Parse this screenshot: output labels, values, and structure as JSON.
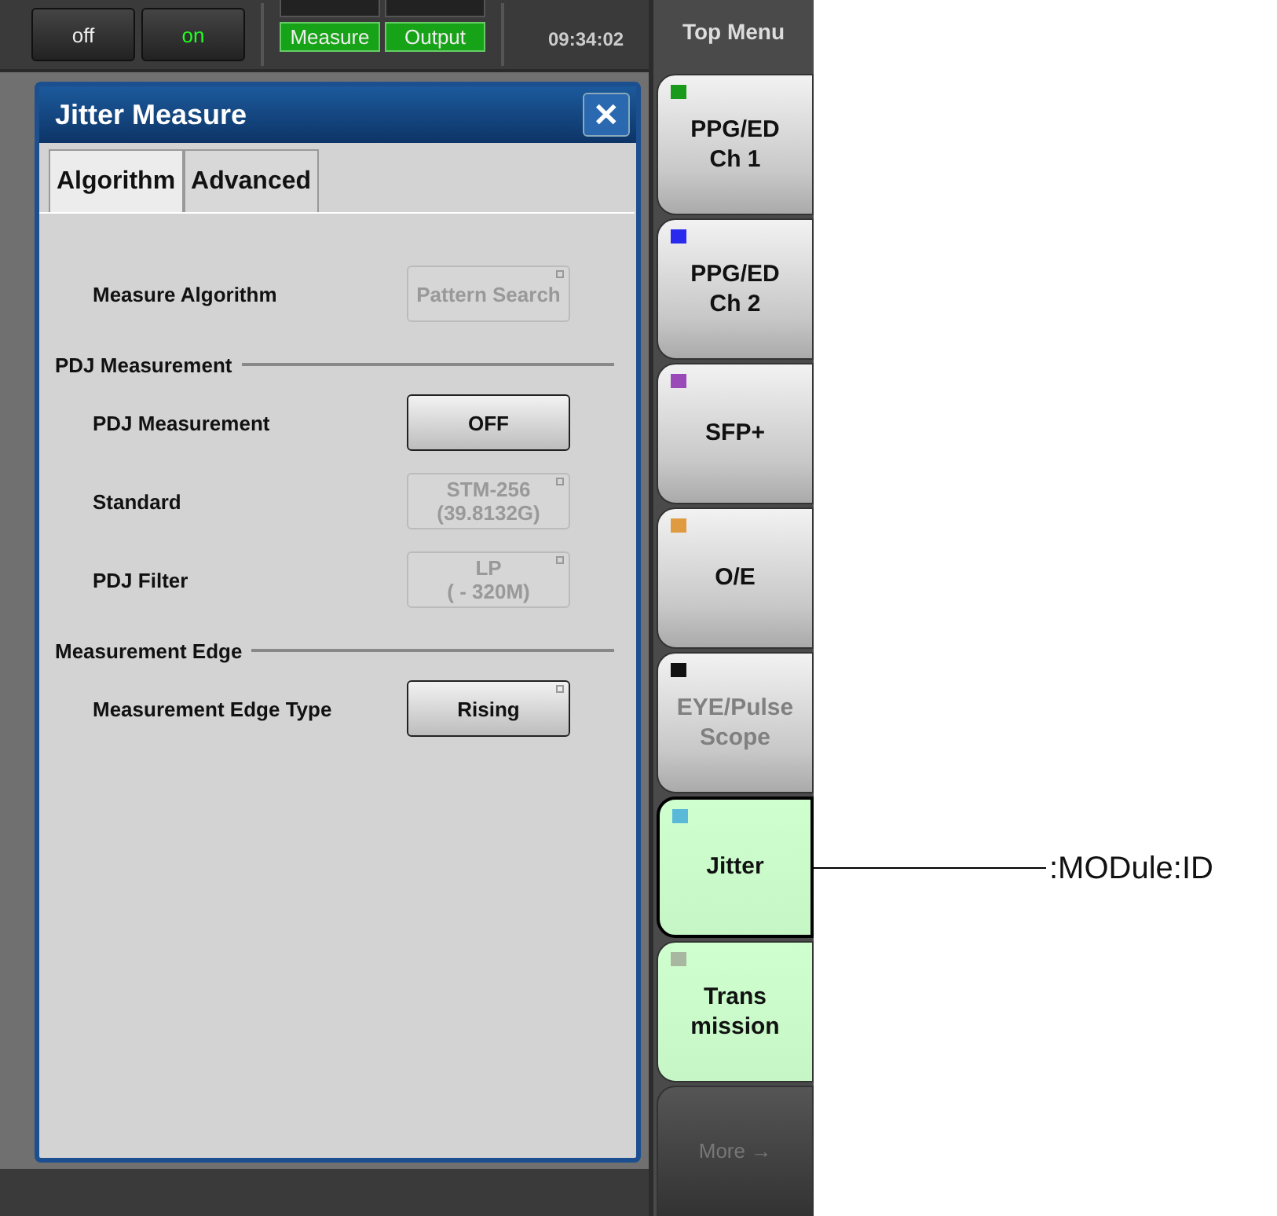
{
  "top_bar": {
    "buttons": [
      {
        "label": "off",
        "on": false
      },
      {
        "label": "on",
        "on": true
      }
    ],
    "indicators": [
      {
        "label": "Measure",
        "lit": true
      },
      {
        "label": "Output",
        "lit": true
      }
    ],
    "time": "09:34:02"
  },
  "dialog": {
    "title": "Jitter Measure",
    "close_label": "✕",
    "tabs": [
      {
        "label": "Algorithm",
        "selected": true
      },
      {
        "label": "Advanced",
        "selected": false
      }
    ],
    "rows": [
      {
        "kind": "setting",
        "label": "Measure Algorithm",
        "value": "Pattern Search",
        "disabled": true,
        "dropdown": true
      },
      {
        "kind": "section",
        "label": "PDJ Measurement"
      },
      {
        "kind": "setting",
        "label": "PDJ Measurement",
        "value": "OFF",
        "disabled": false,
        "dropdown": false
      },
      {
        "kind": "setting",
        "label": "Standard",
        "value": "STM-256\n(39.8132G)",
        "disabled": true,
        "dropdown": true
      },
      {
        "kind": "setting",
        "label": "PDJ Filter",
        "value": "LP\n( - 320M)",
        "disabled": true,
        "dropdown": true
      },
      {
        "kind": "section",
        "label": "Measurement Edge"
      },
      {
        "kind": "setting",
        "label": "Measurement Edge Type",
        "value": "Rising",
        "disabled": false,
        "dropdown": true
      }
    ]
  },
  "side_menu": {
    "title": "Top Menu",
    "items": [
      {
        "label": "PPG/ED\nCh 1",
        "color": "#1a9a1a",
        "active": false,
        "disabled": false,
        "selected": false
      },
      {
        "label": "PPG/ED\nCh 2",
        "color": "#2a2aee",
        "active": false,
        "disabled": false,
        "selected": false
      },
      {
        "label": "SFP+",
        "color": "#9a4ab8",
        "active": false,
        "disabled": false,
        "selected": false
      },
      {
        "label": "O/E",
        "color": "#e09a40",
        "active": false,
        "disabled": false,
        "selected": false
      },
      {
        "label": "EYE/Pulse\nScope",
        "color": "#111111",
        "active": false,
        "disabled": true,
        "selected": false
      },
      {
        "label": "Jitter",
        "color": "#5ab8d8",
        "active": true,
        "disabled": false,
        "selected": true
      },
      {
        "label": "Trans\nmission",
        "color": "#a8b8a0",
        "active": true,
        "disabled": false,
        "selected": false
      }
    ],
    "more": {
      "label": "More",
      "arrow": "→"
    }
  },
  "annotation": {
    "label": ":MODule:ID"
  }
}
